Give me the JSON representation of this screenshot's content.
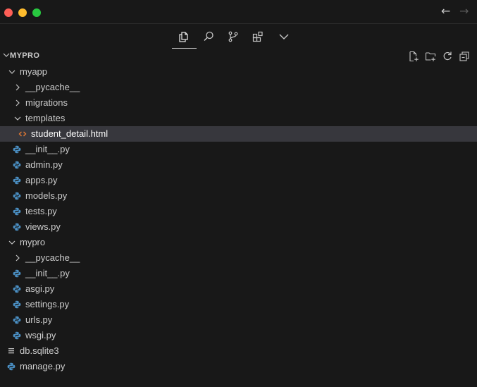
{
  "window": {
    "nav_back": "←",
    "nav_forward": "→"
  },
  "view_switcher": {
    "items": [
      "explorer-icon",
      "search-icon",
      "source-control-icon",
      "extensions-icon",
      "chevron-down-icon"
    ],
    "active": "explorer-icon"
  },
  "explorer": {
    "section_title": "MYPRO",
    "actions": [
      "new-file-icon",
      "new-folder-icon",
      "refresh-icon",
      "collapse-all-icon"
    ]
  },
  "tree": {
    "myapp": "myapp",
    "myapp_pycache": "__pycache__",
    "migrations": "migrations",
    "templates": "templates",
    "student_detail": "student_detail.html",
    "myapp_init": "__init__.py",
    "admin": "admin.py",
    "apps": "apps.py",
    "models": "models.py",
    "tests": "tests.py",
    "views": "views.py",
    "mypro": "mypro",
    "mypro_pycache": "__pycache__",
    "mypro_init": "__init__.py",
    "asgi": "asgi.py",
    "settings": "settings.py",
    "urls": "urls.py",
    "wsgi": "wsgi.py",
    "db": "db.sqlite3",
    "manage": "manage.py"
  },
  "colors": {
    "background": "#181818",
    "selected_row": "#37373d",
    "python_icon": "#4a8ec2",
    "html_icon": "#e37933",
    "text": "#cccccc"
  }
}
